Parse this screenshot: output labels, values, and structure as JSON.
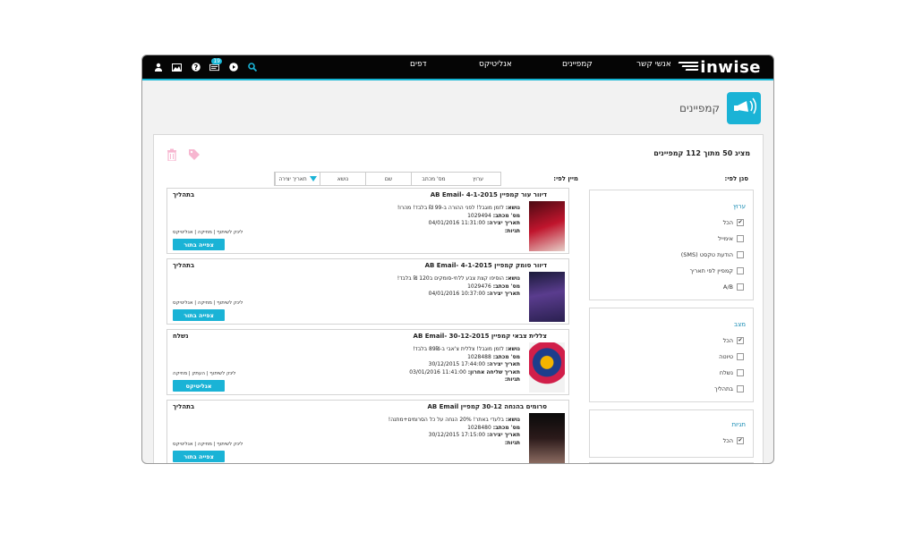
{
  "header": {
    "logo": "inwise",
    "nav": [
      "אנשי קשר",
      "קמפיינים",
      "אנליטיקס",
      "דפים"
    ],
    "notification_count": "19",
    "icons": [
      "search-icon",
      "play-icon",
      "messages-icon",
      "help-icon",
      "image-icon",
      "user-icon"
    ]
  },
  "page": {
    "title": "קמפיינים"
  },
  "list": {
    "count_text": "מציג 50 מתוך 112 קמפיינים",
    "filter_label": "סנן לפי:",
    "sort_label": "מיין לפי:",
    "sort_options": [
      "ערוץ",
      "מס' מכתב",
      "שם",
      "נושא",
      "תאריך יצירה"
    ]
  },
  "filters": {
    "channel": {
      "title": "ערוץ",
      "options": [
        "הכל",
        "אימייל",
        "הודעת טקסט (SMS)",
        "קמפיין לפי תאריך",
        "A/B"
      ],
      "checked": [
        true,
        false,
        false,
        false,
        false
      ]
    },
    "status": {
      "title": "מצב",
      "options": [
        "הכל",
        "טיוטה",
        "נשלח",
        "בתהליך"
      ],
      "checked": [
        true,
        false,
        false,
        false
      ]
    },
    "tags": {
      "title": "תגיות",
      "options": [
        "הכל"
      ],
      "checked": [
        true
      ]
    }
  },
  "campaigns": [
    {
      "title": "דיוור עור קמפיין AB Email- 4-1-2015",
      "status": "בתהליך",
      "subject_label": "נושא:",
      "subject": "לזמן מוגבל! לפני ההורה ב-99 ₪ בלבד! מהרו!",
      "number_label": "מס' מכתב:",
      "number": "1029494",
      "created_label": "תאריך יצירה:",
      "created": "11:31:00 04/01/2016",
      "sent_label": "",
      "sent": "",
      "tags_label": "תגיות:",
      "links": "לינק לשיתוף | מחיקה | אנליטיקס",
      "button": "צפייה בתור"
    },
    {
      "title": "דיוור סומק קמפיין AB Email- 4-1-2015",
      "status": "בתהליך",
      "subject_label": "נושא:",
      "subject": "הוסיפו קצת צבע ללחי-סומקים ב120 ₪ בלבד!",
      "number_label": "מס' מכתב:",
      "number": "1029476",
      "created_label": "תאריך יצירה:",
      "created": "10:37:00 04/01/2016",
      "sent_label": "",
      "sent": "",
      "tags_label": "תגיות:",
      "links": "לינק לשיתוף | מחיקה | אנליטיקס",
      "button": "צפייה בתור"
    },
    {
      "title": "צללית צבאי קמפיין AB Email- 30-12-2015",
      "status": "נשלח",
      "subject_label": "נושא:",
      "subject": "לזמן מוגבל! צללית צ'אבי ב-89₪ בלבד!",
      "number_label": "מס' מכתב:",
      "number": "1028488",
      "created_label": "תאריך יצירה:",
      "created": "17:44:00 30/12/2015",
      "sent_label": "תאריך שליחה אחרון:",
      "sent": "11:41:00 03/01/2016",
      "tags_label": "תגיות:",
      "links": "לינק לשיתוף | העתק | מחיקה",
      "button": "אנליטיקס"
    },
    {
      "title": "סרומים בהנחה 30-12 קמפיין AB Email",
      "status": "בתהליך",
      "subject_label": "נושא:",
      "subject": "בלעדי באתר! 20% הנחה על כל הסרומים+מתנה!",
      "number_label": "מס' מכתב:",
      "number": "1028480",
      "created_label": "תאריך יצירה:",
      "created": "17:15:00 30/12/2015",
      "sent_label": "",
      "sent": "",
      "tags_label": "תגיות:",
      "links": "לינק לשיתוף | מחיקה | אנליטיקס",
      "button": "צפייה בתור"
    }
  ],
  "colors": {
    "accent": "#1ab3d6",
    "topbar": "#050505",
    "background": "#f2f2f2"
  }
}
